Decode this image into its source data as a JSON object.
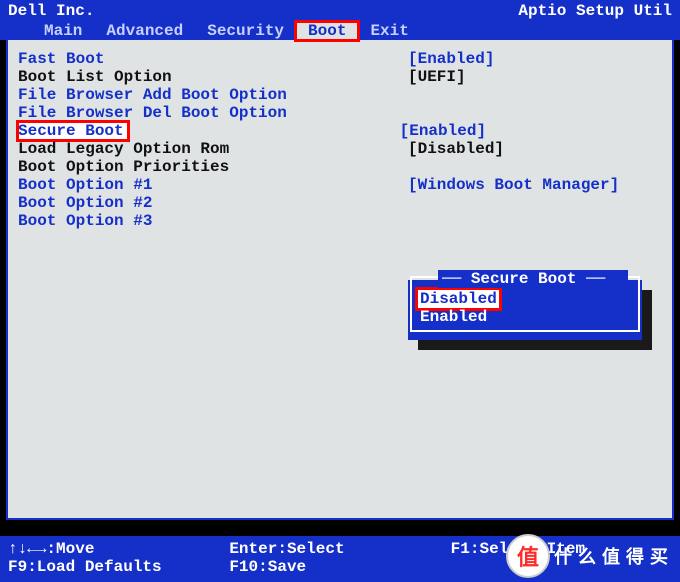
{
  "header": {
    "vendor": "Dell Inc.",
    "utility": "Aptio Setup Util",
    "tabs": [
      "Main",
      "Advanced",
      "Security",
      "Boot",
      "Exit"
    ],
    "active_tab_index": 3
  },
  "rows": [
    {
      "label": "Fast Boot",
      "value": "[Enabled]",
      "label_cls": "blue-txt",
      "val_cls": "blue-txt",
      "interactable": true
    },
    {
      "label": "",
      "value": "",
      "label_cls": "",
      "val_cls": "",
      "interactable": false
    },
    {
      "label": "Boot List Option",
      "value": "[UEFI]",
      "label_cls": "black-txt",
      "val_cls": "black-txt",
      "interactable": true
    },
    {
      "label": "File Browser Add Boot Option",
      "value": "",
      "label_cls": "blue-txt",
      "val_cls": "",
      "interactable": true
    },
    {
      "label": "File Browser Del Boot Option",
      "value": "",
      "label_cls": "blue-txt",
      "val_cls": "",
      "interactable": true
    },
    {
      "label": "Secure Boot",
      "value": "[Enabled]",
      "label_cls": "sel",
      "val_cls": "blue-txt",
      "interactable": true,
      "highlight": true
    },
    {
      "label": "Load Legacy Option Rom",
      "value": "[Disabled]",
      "label_cls": "black-txt",
      "val_cls": "black-txt",
      "interactable": true
    },
    {
      "label": "",
      "value": "",
      "label_cls": "",
      "val_cls": "",
      "interactable": false
    },
    {
      "label": "Boot Option Priorities",
      "value": "",
      "label_cls": "black-txt",
      "val_cls": "",
      "interactable": false
    },
    {
      "label": "Boot Option #1",
      "value": "[Windows Boot Manager]",
      "label_cls": "blue-txt",
      "val_cls": "blue-txt",
      "interactable": true
    },
    {
      "label": "Boot Option #2",
      "value": "",
      "label_cls": "blue-txt",
      "val_cls": "",
      "interactable": true
    },
    {
      "label": "Boot Option #3",
      "value": "",
      "label_cls": "blue-txt",
      "val_cls": "",
      "interactable": true
    }
  ],
  "popup": {
    "title": "Secure Boot",
    "items": [
      "Disabled",
      "Enabled"
    ],
    "selected_index": 0
  },
  "footer": {
    "r1c1": "↑↓←→:Move",
    "r1c2": "Enter:Select",
    "r1c3": "F1:Select Item",
    "r2c1": "F9:Load Defaults",
    "r2c2": "F10:Save",
    "r2c3": ""
  },
  "watermark": {
    "char": "值",
    "text": "什么值得买"
  }
}
